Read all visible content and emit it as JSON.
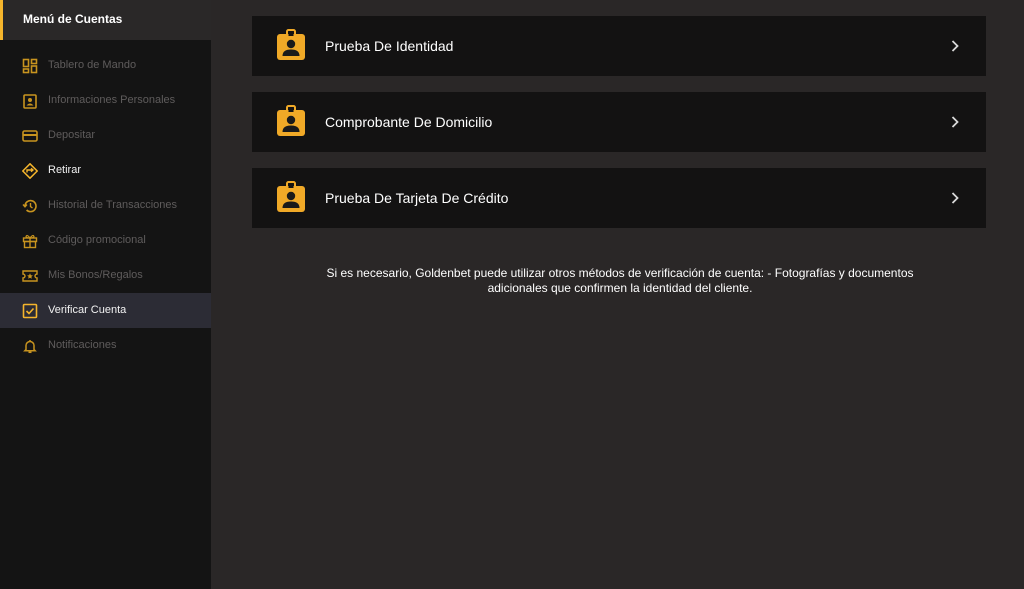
{
  "sidebar": {
    "title": "Menú de Cuentas",
    "items": [
      {
        "label": "Tablero de Mando",
        "icon": "dashboard-icon"
      },
      {
        "label": "Informaciones Personales",
        "icon": "id-card-icon"
      },
      {
        "label": "Depositar",
        "icon": "credit-card-icon"
      },
      {
        "label": "Retirar",
        "icon": "withdraw-icon"
      },
      {
        "label": "Historial de Transacciones",
        "icon": "history-icon"
      },
      {
        "label": "Código promocional",
        "icon": "gift-icon"
      },
      {
        "label": "Mis Bonos/Regalos",
        "icon": "ticket-icon"
      },
      {
        "label": "Verificar Cuenta",
        "icon": "checkbox-icon",
        "active": true
      },
      {
        "label": "Notificaciones",
        "icon": "bell-icon"
      }
    ]
  },
  "main": {
    "cards": [
      {
        "label": "Prueba De Identidad",
        "icon": "identity-badge-icon"
      },
      {
        "label": "Comprobante De Domicilio",
        "icon": "identity-badge-icon"
      },
      {
        "label": "Prueba De Tarjeta De Crédito",
        "icon": "identity-badge-icon"
      }
    ],
    "note": "Si es necesario, Goldenbet puede utilizar otros métodos de verificación de cuenta: - Fotografías y documentos adicionales que confirmen la identidad del cliente."
  },
  "colors": {
    "accent": "#f5b52c",
    "sidebar_bg": "#141414",
    "main_bg": "#2a2727",
    "card_bg": "#131212",
    "active_bg": "#2c2c35"
  }
}
